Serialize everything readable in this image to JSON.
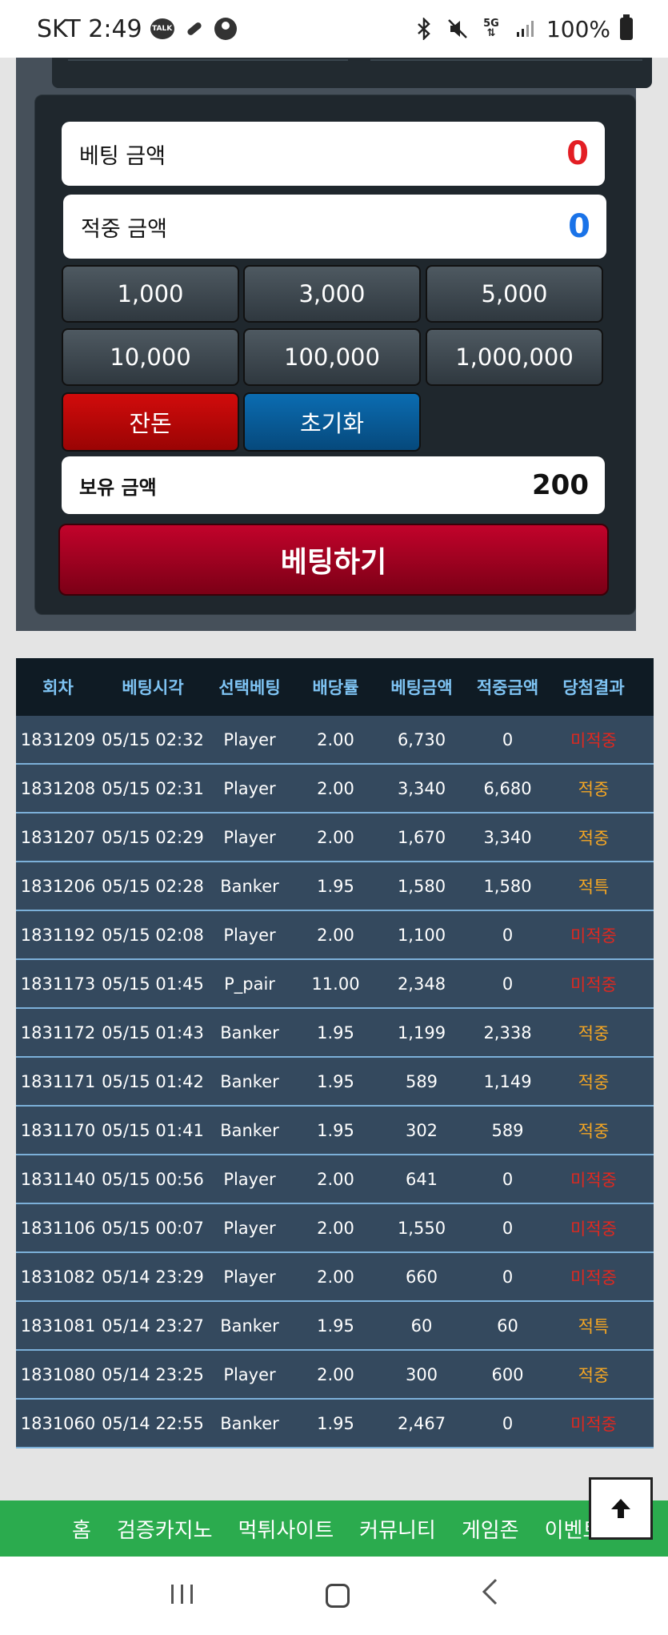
{
  "status_bar": {
    "carrier_time": "SKT 2:49",
    "talk_label": "TALK",
    "battery": "100%",
    "network": "5G",
    "icons": [
      "kakaotalk-icon",
      "pill-icon",
      "account-icon",
      "bluetooth-icon",
      "mute-icon",
      "5g-icon",
      "signal-icon",
      "battery-icon"
    ]
  },
  "bet_panel": {
    "bet_amount_label": "베팅 금액",
    "bet_amount_value": "0",
    "win_amount_label": "적중 금액",
    "win_amount_value": "0",
    "chips": [
      "1,000",
      "3,000",
      "5,000",
      "10,000",
      "100,000",
      "1,000,000"
    ],
    "balance_button": "잔돈",
    "reset_button": "초기화",
    "holding_label": "보유 금액",
    "holding_value": "200",
    "bet_button": "베팅하기"
  },
  "history": {
    "headers": [
      "회차",
      "베팅시각",
      "선택베팅",
      "배당률",
      "베팅금액",
      "적중금액",
      "당첨결과"
    ],
    "rows": [
      {
        "round": "1831209",
        "time": "05/15 02:32",
        "pick": "Player",
        "odds": "2.00",
        "bet": "6,730",
        "win": "0",
        "result": "미적중",
        "status": "miss"
      },
      {
        "round": "1831208",
        "time": "05/15 02:31",
        "pick": "Player",
        "odds": "2.00",
        "bet": "3,340",
        "win": "6,680",
        "result": "적중",
        "status": "hit"
      },
      {
        "round": "1831207",
        "time": "05/15 02:29",
        "pick": "Player",
        "odds": "2.00",
        "bet": "1,670",
        "win": "3,340",
        "result": "적중",
        "status": "hit"
      },
      {
        "round": "1831206",
        "time": "05/15 02:28",
        "pick": "Banker",
        "odds": "1.95",
        "bet": "1,580",
        "win": "1,580",
        "result": "적특",
        "status": "hit"
      },
      {
        "round": "1831192",
        "time": "05/15 02:08",
        "pick": "Player",
        "odds": "2.00",
        "bet": "1,100",
        "win": "0",
        "result": "미적중",
        "status": "miss"
      },
      {
        "round": "1831173",
        "time": "05/15 01:45",
        "pick": "P_pair",
        "odds": "11.00",
        "bet": "2,348",
        "win": "0",
        "result": "미적중",
        "status": "miss"
      },
      {
        "round": "1831172",
        "time": "05/15 01:43",
        "pick": "Banker",
        "odds": "1.95",
        "bet": "1,199",
        "win": "2,338",
        "result": "적중",
        "status": "hit"
      },
      {
        "round": "1831171",
        "time": "05/15 01:42",
        "pick": "Banker",
        "odds": "1.95",
        "bet": "589",
        "win": "1,149",
        "result": "적중",
        "status": "hit"
      },
      {
        "round": "1831170",
        "time": "05/15 01:41",
        "pick": "Banker",
        "odds": "1.95",
        "bet": "302",
        "win": "589",
        "result": "적중",
        "status": "hit"
      },
      {
        "round": "1831140",
        "time": "05/15 00:56",
        "pick": "Player",
        "odds": "2.00",
        "bet": "641",
        "win": "0",
        "result": "미적중",
        "status": "miss"
      },
      {
        "round": "1831106",
        "time": "05/15 00:07",
        "pick": "Player",
        "odds": "2.00",
        "bet": "1,550",
        "win": "0",
        "result": "미적중",
        "status": "miss"
      },
      {
        "round": "1831082",
        "time": "05/14 23:29",
        "pick": "Player",
        "odds": "2.00",
        "bet": "660",
        "win": "0",
        "result": "미적중",
        "status": "miss"
      },
      {
        "round": "1831081",
        "time": "05/14 23:27",
        "pick": "Banker",
        "odds": "1.95",
        "bet": "60",
        "win": "60",
        "result": "적특",
        "status": "hit"
      },
      {
        "round": "1831080",
        "time": "05/14 23:25",
        "pick": "Player",
        "odds": "2.00",
        "bet": "300",
        "win": "600",
        "result": "적중",
        "status": "hit"
      },
      {
        "round": "1831060",
        "time": "05/14 22:55",
        "pick": "Banker",
        "odds": "1.95",
        "bet": "2,467",
        "win": "0",
        "result": "미적중",
        "status": "miss"
      }
    ]
  },
  "bottom_nav": {
    "items": [
      "홈",
      "검증카지노",
      "먹튀사이트",
      "커뮤니티",
      "게임존",
      "이벤트"
    ]
  },
  "colors": {
    "hit": "#f5a623",
    "miss": "#e0281f",
    "nav_green": "#2bab4e",
    "header_text": "#7fc4f4"
  }
}
